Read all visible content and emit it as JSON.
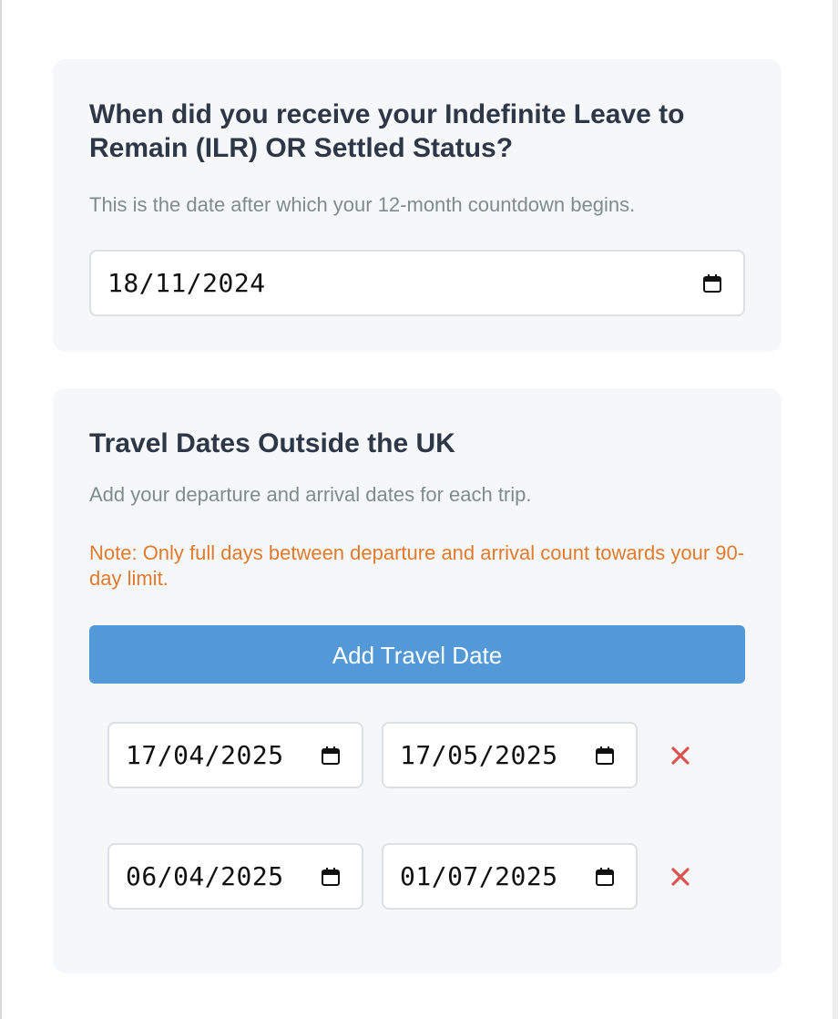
{
  "ilr": {
    "title": "When did you receive your Indefinite Leave to Remain (ILR) OR Settled Status?",
    "description": "This is the date after which your 12-month countdown begins.",
    "date_value": "18/11/2024"
  },
  "travel": {
    "title": "Travel Dates Outside the UK",
    "description": "Add your departure and arrival dates for each trip.",
    "note": "Note: Only full days between departure and arrival count towards your 90-day limit.",
    "add_button_label": "Add Travel Date",
    "trips": [
      {
        "departure": "17/04/2025",
        "arrival": "17/05/2025"
      },
      {
        "departure": "06/04/2025",
        "arrival": "01/07/2025"
      }
    ]
  },
  "colors": {
    "card_background": "#f5f7f9",
    "heading": "#2d3748",
    "muted_text": "#7f8c8d",
    "note_text": "#e07b2c",
    "button_background": "#5499d7",
    "remove_icon": "#d9534f"
  },
  "icons": {
    "date_picker": "calendar-icon",
    "remove_trip": "close-icon"
  }
}
